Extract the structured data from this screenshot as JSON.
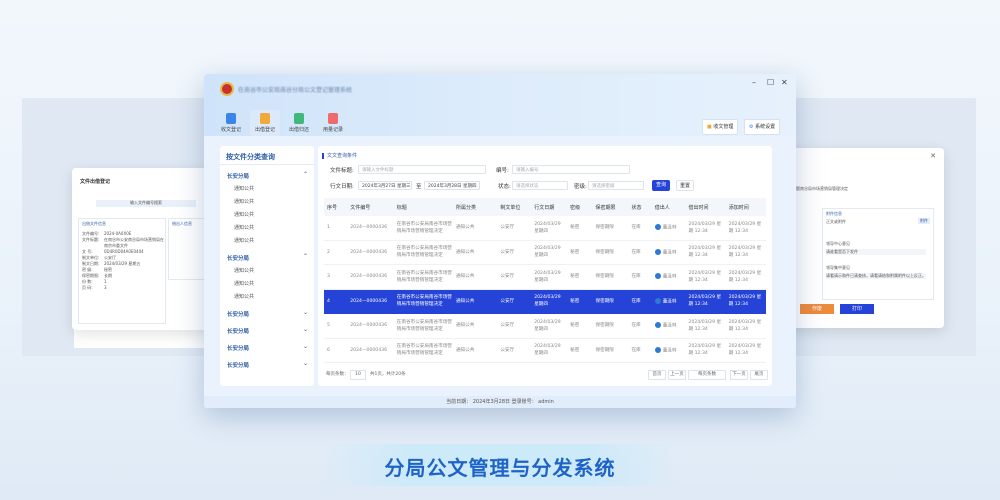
{
  "caption": "分局公文管理与分发系统",
  "left_window": {
    "dialog_title": "文件出借登记",
    "input_label": "输入文件编号搜索",
    "section": "出借文件信息",
    "fields": [
      {
        "label": "文件编号:",
        "value": "2024-0A0X0E"
      },
      {
        "label": "文件标题:",
        "value": "在南谷市公安南谷局市场营销局在南京市委文件"
      },
      {
        "label": "文   号:",
        "value": "0D4R0D04A0E0404"
      },
      {
        "label": "制文单位:",
        "value": "公安厅"
      },
      {
        "label": "制文日期:",
        "value": "2024/03/29 星期五"
      },
      {
        "label": "密   级:",
        "value": "秘密"
      },
      {
        "label": "保密期限:",
        "value": "长期"
      },
      {
        "label": "份   数:",
        "value": "1"
      },
      {
        "label": "页   码:",
        "value": "3"
      }
    ],
    "right_label": "借出人信息"
  },
  "right_window": {
    "top_text": "文件标题南谷局市场营销局管理决定",
    "section": "附件信息",
    "attach": "正文或附件",
    "tag": "附件",
    "review_label": "领导中心意见",
    "review_value": "请谁看是否下发件",
    "opinion_label": "领导集中意见",
    "opinion_value": "请看请示和件已清查核，请看请结和附属附件以上反正。",
    "cancel": "作废",
    "print": "打印"
  },
  "window": {
    "title": "在南谷市公安局南谷分局公文登记管理系统",
    "controls": {
      "minimize": "–",
      "maximize": "☐",
      "close": "✕"
    },
    "nav": [
      {
        "label": "收文登记",
        "color": "#3a86e8",
        "active": false
      },
      {
        "label": "出借登记",
        "color": "#f2a93b",
        "active": true
      },
      {
        "label": "出借归还",
        "color": "#3fb97a",
        "active": false
      },
      {
        "label": "用量记录",
        "color": "#ef6b6b",
        "active": false
      }
    ],
    "top_buttons": {
      "received_mgmt": "收文管理",
      "system_settings": "系统设置"
    },
    "status": "当前日期： 2024年3月28日    登录账号： admin"
  },
  "sidebar": {
    "title": "按文件分类查询",
    "groups": [
      {
        "label": "长安分局",
        "expanded": true,
        "items": [
          "通知公共",
          "通知公共",
          "通知公共",
          "通知公共",
          "通知公共"
        ]
      },
      {
        "label": "长安分局",
        "expanded": true,
        "items": [
          "通知公共",
          "通知公共",
          "通知公共"
        ]
      },
      {
        "label": "长安分局",
        "expanded": false,
        "items": []
      },
      {
        "label": "长安分局",
        "expanded": false,
        "items": []
      },
      {
        "label": "长安分局",
        "expanded": false,
        "items": []
      },
      {
        "label": "长安分局",
        "expanded": false,
        "items": []
      }
    ]
  },
  "query": {
    "heading": "文文查询条件",
    "title_label": "文件标题:",
    "title_placeholder": "请输入文件标题",
    "number_label": "编号:",
    "number_placeholder": "请输入编号",
    "date_label": "行文日期:",
    "date_from": "2024年3月27日 星期三",
    "date_sep": "至",
    "date_to": "2024年3月28日 星期四",
    "status_label": "状态:",
    "status_placeholder": "请选择状态",
    "level_label": "密级:",
    "level_placeholder": "请选择密级",
    "search_button": "查询",
    "reset_button": "重置"
  },
  "table": {
    "columns": [
      "序号",
      "文件编号",
      "标题",
      "所属分类",
      "制文单位",
      "行文日期",
      "密级",
      "保密期限",
      "状态",
      "借出人",
      "借出时间",
      "添加时间"
    ],
    "rows": [
      {
        "no": "1",
        "code": "2024—0000436",
        "title": "在南谷市公安局南谷市场营销局市场营销管理决定",
        "cat": "通知公共",
        "unit": "公安厅",
        "date": "2024/03/29 星期四",
        "level": "秘密",
        "period": "保密期限",
        "status": "在库",
        "person": "董泽林",
        "out_time": "2024/03/29 星期 12:34",
        "add_time": "2024/03/29 星期 12:34"
      },
      {
        "no": "2",
        "code": "2024—0000436",
        "title": "在南谷市公安局南谷市场营销局市场营销管理决定",
        "cat": "通知公共",
        "unit": "公安厅",
        "date": "2024/03/29 星期四",
        "level": "秘密",
        "period": "保密期限",
        "status": "在库",
        "person": "董泽林",
        "out_time": "2024/03/29 星期 12:34",
        "add_time": "2024/03/29 星期 12:34"
      },
      {
        "no": "3",
        "code": "2024—0000436",
        "title": "在南谷市公安局南谷市场营销局市场营销管理决定",
        "cat": "通知公共",
        "unit": "公安厅",
        "date": "2024/03/29 星期四",
        "level": "秘密",
        "period": "保密期限",
        "status": "在库",
        "person": "董泽林",
        "out_time": "2024/03/29 星期 12:34",
        "add_time": "2024/03/29 星期 12:34"
      },
      {
        "no": "4",
        "code": "2024—0000436",
        "title": "在南谷市公安局南谷市场营销局市场营销管理决定",
        "cat": "通知公共",
        "unit": "公安厅",
        "date": "2024/03/29 星期四",
        "level": "秘密",
        "period": "保密期限",
        "status": "在库",
        "person": "董泽林",
        "out_time": "2024/03/29 星期 12:34",
        "add_time": "2024/03/29 星期 12:34"
      },
      {
        "no": "5",
        "code": "2024—0000436",
        "title": "在南谷市公安局南谷市场营销局市场营销管理决定",
        "cat": "通知公共",
        "unit": "公安厅",
        "date": "2024/03/29 星期四",
        "level": "秘密",
        "period": "保密期限",
        "status": "在库",
        "person": "董泽林",
        "out_time": "2024/03/29 星期 12:34",
        "add_time": "2024/03/29 星期 12:34"
      },
      {
        "no": "6",
        "code": "2024—0000436",
        "title": "在南谷市公安局南谷市场营销局市场营销管理决定",
        "cat": "通知公共",
        "unit": "公安厅",
        "date": "2024/03/29 星期四",
        "level": "秘密",
        "period": "保密期限",
        "status": "在库",
        "person": "董泽林",
        "out_time": "2024/03/29 星期 12:34",
        "add_time": "2024/03/29 星期 12:34"
      }
    ],
    "selected_row": 3
  },
  "pagination": {
    "per_page_label": "每页条数：",
    "per_page_value": "10",
    "summary": "共1页，共计20条",
    "first": "首页",
    "prev": "上一页",
    "page_select": "每页条数",
    "next": "下一页",
    "last": "尾页"
  },
  "colors": {
    "accent": "#2643d8",
    "brand": "#1f63c8"
  }
}
